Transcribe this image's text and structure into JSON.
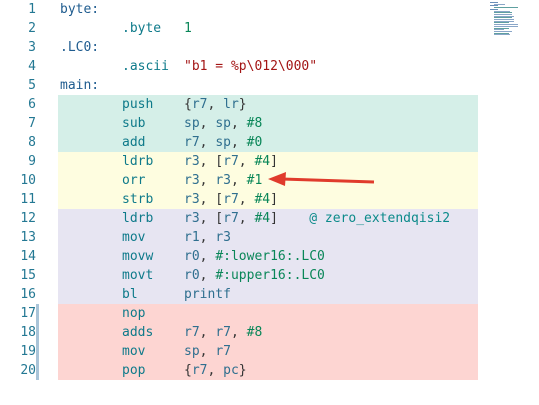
{
  "lines": [
    {
      "num": "1",
      "label": "byte:",
      "op": "",
      "args": "",
      "comment": "",
      "bg": ""
    },
    {
      "num": "2",
      "label": "",
      "op": ".byte",
      "args": "1",
      "comment": "",
      "bg": ""
    },
    {
      "num": "3",
      "label": ".LC0:",
      "op": "",
      "args": "",
      "comment": "",
      "bg": ""
    },
    {
      "num": "4",
      "label": "",
      "op": ".ascii",
      "args": "\"b1 = %p\\012\\000\"",
      "comment": "",
      "bg": ""
    },
    {
      "num": "5",
      "label": "main:",
      "op": "",
      "args": "",
      "comment": "",
      "bg": ""
    },
    {
      "num": "6",
      "label": "",
      "op": "push",
      "args": "{r7, lr}",
      "comment": "",
      "bg": "#d5efe8"
    },
    {
      "num": "7",
      "label": "",
      "op": "sub",
      "args": "sp, sp, #8",
      "comment": "",
      "bg": "#d5efe8"
    },
    {
      "num": "8",
      "label": "",
      "op": "add",
      "args": "r7, sp, #0",
      "comment": "",
      "bg": "#d5efe8"
    },
    {
      "num": "9",
      "label": "",
      "op": "ldrb",
      "args": "r3, [r7, #4]",
      "comment": "",
      "bg": "#fefde0"
    },
    {
      "num": "10",
      "label": "",
      "op": "orr",
      "args": "r3, r3, #1",
      "comment": "",
      "bg": "#fefde0"
    },
    {
      "num": "11",
      "label": "",
      "op": "strb",
      "args": "r3, [r7, #4]",
      "comment": "",
      "bg": "#fefde0"
    },
    {
      "num": "12",
      "label": "",
      "op": "ldrb",
      "args": "r3, [r7, #4]",
      "comment": "@ zero_extendqisi2",
      "bg": "#e7e5f2"
    },
    {
      "num": "13",
      "label": "",
      "op": "mov",
      "args": "r1, r3",
      "comment": "",
      "bg": "#e7e5f2"
    },
    {
      "num": "14",
      "label": "",
      "op": "movw",
      "args": "r0, #:lower16:.LC0",
      "comment": "",
      "bg": "#e7e5f2"
    },
    {
      "num": "15",
      "label": "",
      "op": "movt",
      "args": "r0, #:upper16:.LC0",
      "comment": "",
      "bg": "#e7e5f2"
    },
    {
      "num": "16",
      "label": "",
      "op": "bl",
      "args": "printf",
      "comment": "",
      "bg": "#e7e5f2"
    },
    {
      "num": "17",
      "label": "",
      "op": "nop",
      "args": "",
      "comment": "",
      "bg": "#fdd5d2"
    },
    {
      "num": "18",
      "label": "",
      "op": "adds",
      "args": "r7, r7, #8",
      "comment": "",
      "bg": "#fdd5d2"
    },
    {
      "num": "19",
      "label": "",
      "op": "mov",
      "args": "sp, r7",
      "comment": "",
      "bg": "#fdd5d2"
    },
    {
      "num": "20",
      "label": "",
      "op": "pop",
      "args": "{r7, pc}",
      "comment": "",
      "bg": "#fdd5d2"
    }
  ],
  "gutter_bar_color": "#a9c4d8",
  "arrow_color": "#e03b2c"
}
